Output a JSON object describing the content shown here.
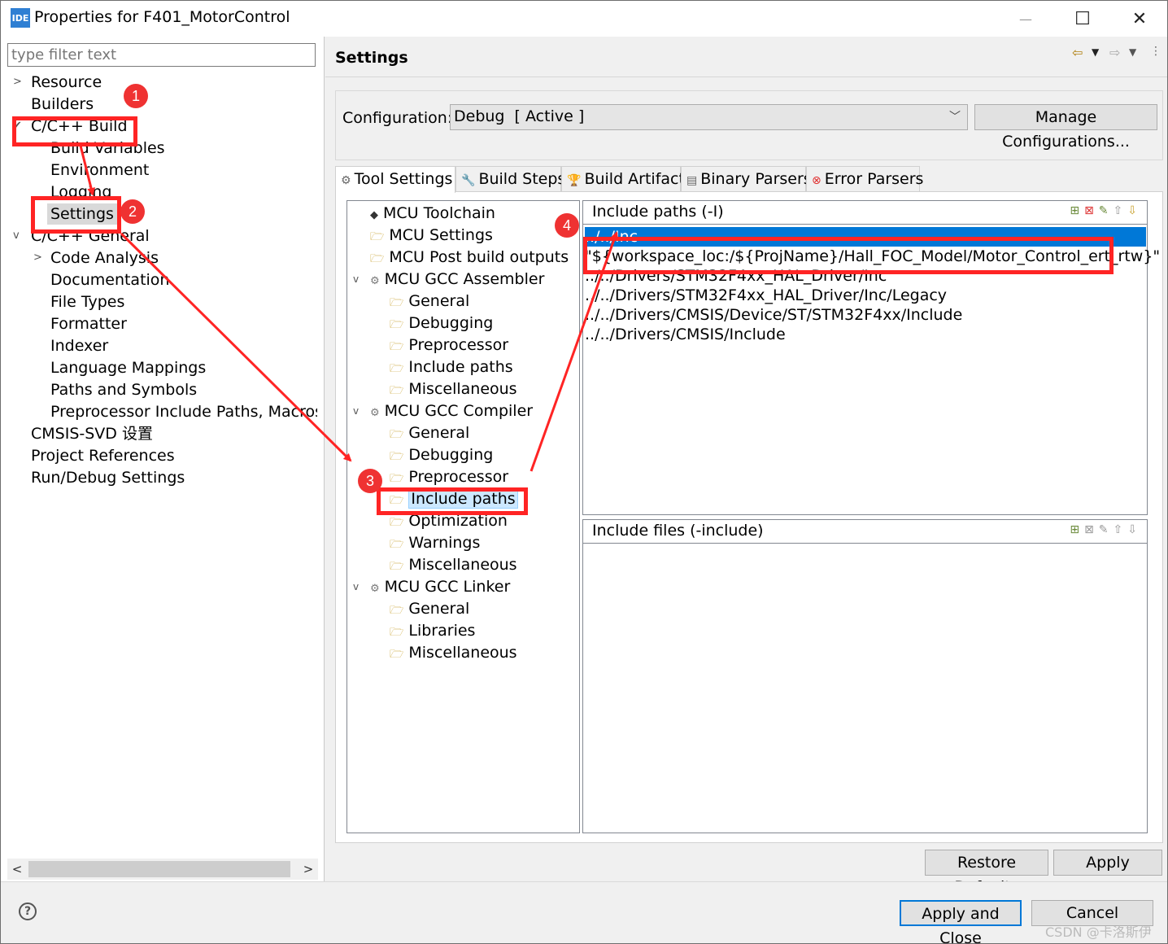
{
  "window": {
    "app_icon_text": "IDE",
    "title": "Properties for F401_MotorControl",
    "minimize_glyph": "—",
    "maximize_glyph": "☐",
    "close_glyph": "✕"
  },
  "left": {
    "filter_placeholder": "type filter text",
    "items": [
      {
        "label": "Resource"
      },
      {
        "label": "Builders"
      },
      {
        "label": "C/C++ Build"
      },
      {
        "label": "Build Variables"
      },
      {
        "label": "Environment"
      },
      {
        "label": "Logging"
      },
      {
        "label": "Settings"
      },
      {
        "label": "C/C++ General"
      },
      {
        "label": "Code Analysis"
      },
      {
        "label": "Documentation"
      },
      {
        "label": "File Types"
      },
      {
        "label": "Formatter"
      },
      {
        "label": "Indexer"
      },
      {
        "label": "Language Mappings"
      },
      {
        "label": "Paths and Symbols"
      },
      {
        "label": "Preprocessor Include Paths, Macros etc."
      },
      {
        "label": "CMSIS-SVD 设置"
      },
      {
        "label": "Project References"
      },
      {
        "label": "Run/Debug Settings"
      }
    ]
  },
  "header": {
    "title": "Settings"
  },
  "config": {
    "label": "Configuration:",
    "value": "Debug  [ Active ]",
    "manage_label": "Manage Configurations..."
  },
  "tabs": [
    {
      "label": "Tool Settings",
      "icon": "gear-icon"
    },
    {
      "label": "Build Steps",
      "icon": "wrench-icon"
    },
    {
      "label": "Build Artifact",
      "icon": "trophy-icon"
    },
    {
      "label": "Binary Parsers",
      "icon": "binary-icon"
    },
    {
      "label": "Error Parsers",
      "icon": "error-icon"
    }
  ],
  "tool_tree": [
    {
      "label": "MCU Toolchain"
    },
    {
      "label": "MCU Settings"
    },
    {
      "label": "MCU Post build outputs"
    },
    {
      "label": "MCU GCC Assembler"
    },
    {
      "label": "General"
    },
    {
      "label": "Debugging"
    },
    {
      "label": "Preprocessor"
    },
    {
      "label": "Include paths"
    },
    {
      "label": "Miscellaneous"
    },
    {
      "label": "MCU GCC Compiler"
    },
    {
      "label": "General"
    },
    {
      "label": "Debugging"
    },
    {
      "label": "Preprocessor"
    },
    {
      "label": "Include paths"
    },
    {
      "label": "Optimization"
    },
    {
      "label": "Warnings"
    },
    {
      "label": "Miscellaneous"
    },
    {
      "label": "MCU GCC Linker"
    },
    {
      "label": "General"
    },
    {
      "label": "Libraries"
    },
    {
      "label": "Miscellaneous"
    }
  ],
  "include_paths": {
    "title": "Include paths (-I)",
    "rows": [
      "../../Inc",
      "\"${workspace_loc:/${ProjName}/Hall_FOC_Model/Motor_Control_ert_rtw}\"",
      "../../Drivers/STM32F4xx_HAL_Driver/Inc",
      "../../Drivers/STM32F4xx_HAL_Driver/Inc/Legacy",
      "../../Drivers/CMSIS/Device/ST/STM32F4xx/Include",
      "../../Drivers/CMSIS/Include"
    ]
  },
  "include_files": {
    "title": "Include files (-include)"
  },
  "buttons": {
    "restore_defaults": "Restore Defaults",
    "apply": "Apply",
    "apply_close": "Apply and Close",
    "cancel": "Cancel"
  },
  "help_glyph": "?",
  "annotations": [
    "1",
    "2",
    "3",
    "4"
  ],
  "watermark": "CSDN @卡洛斯伊",
  "colors": {
    "annotation": "#ff2424",
    "selection": "#0078d7"
  }
}
